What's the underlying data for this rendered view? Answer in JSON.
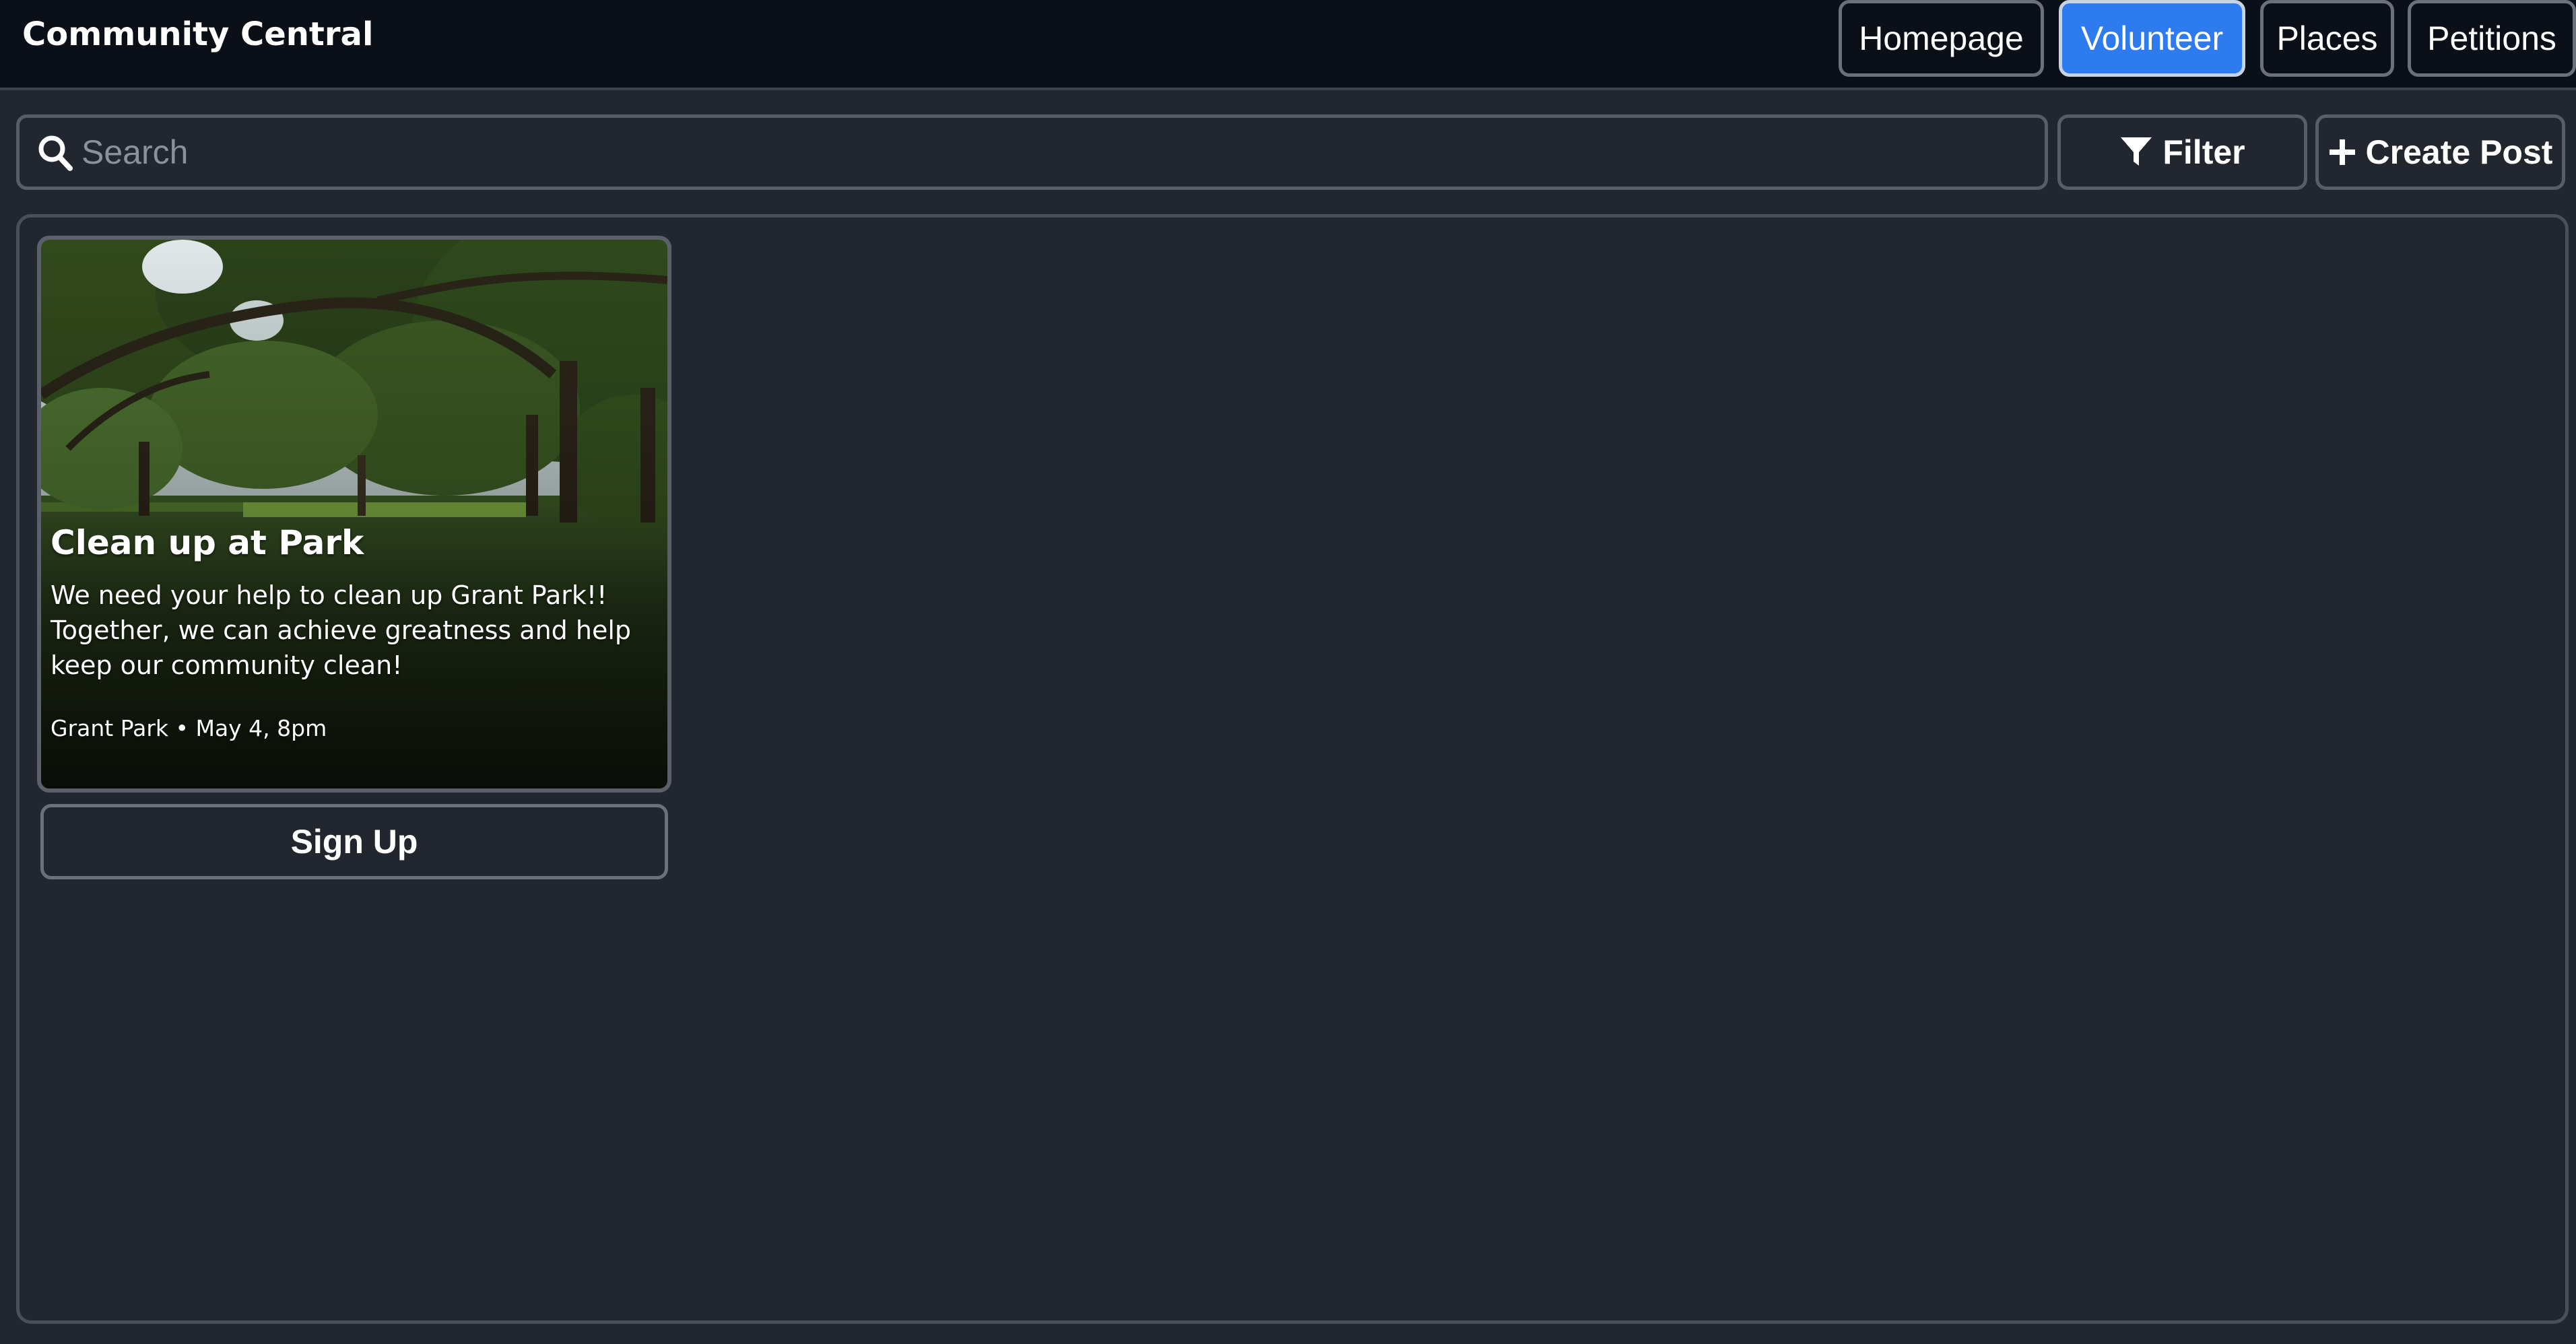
{
  "header": {
    "title": "Community Central",
    "tabs": [
      {
        "label": "Homepage",
        "active": false
      },
      {
        "label": "Volunteer",
        "active": true
      },
      {
        "label": "Places",
        "active": false
      },
      {
        "label": "Petitions",
        "active": false
      }
    ]
  },
  "toolbar": {
    "search_placeholder": "Search",
    "search_value": "",
    "search_icon": "magnifying-glass",
    "filter_label": "Filter",
    "filter_icon": "funnel",
    "create_label": "Create Post",
    "create_icon": "plus"
  },
  "posts": [
    {
      "title": "Clean up at Park",
      "description": "We need your help to clean up Grant Park!! Together, we can achieve greatness and help keep our community clean!",
      "meta": "Grant Park • May 4, 8pm",
      "image": "park-with-trees-photo",
      "action_label": "Sign Up"
    }
  ],
  "colors": {
    "header_bg": "#0b1018",
    "page_bg": "#22262e",
    "accent": "#2d7bee",
    "border": "#585e68"
  }
}
